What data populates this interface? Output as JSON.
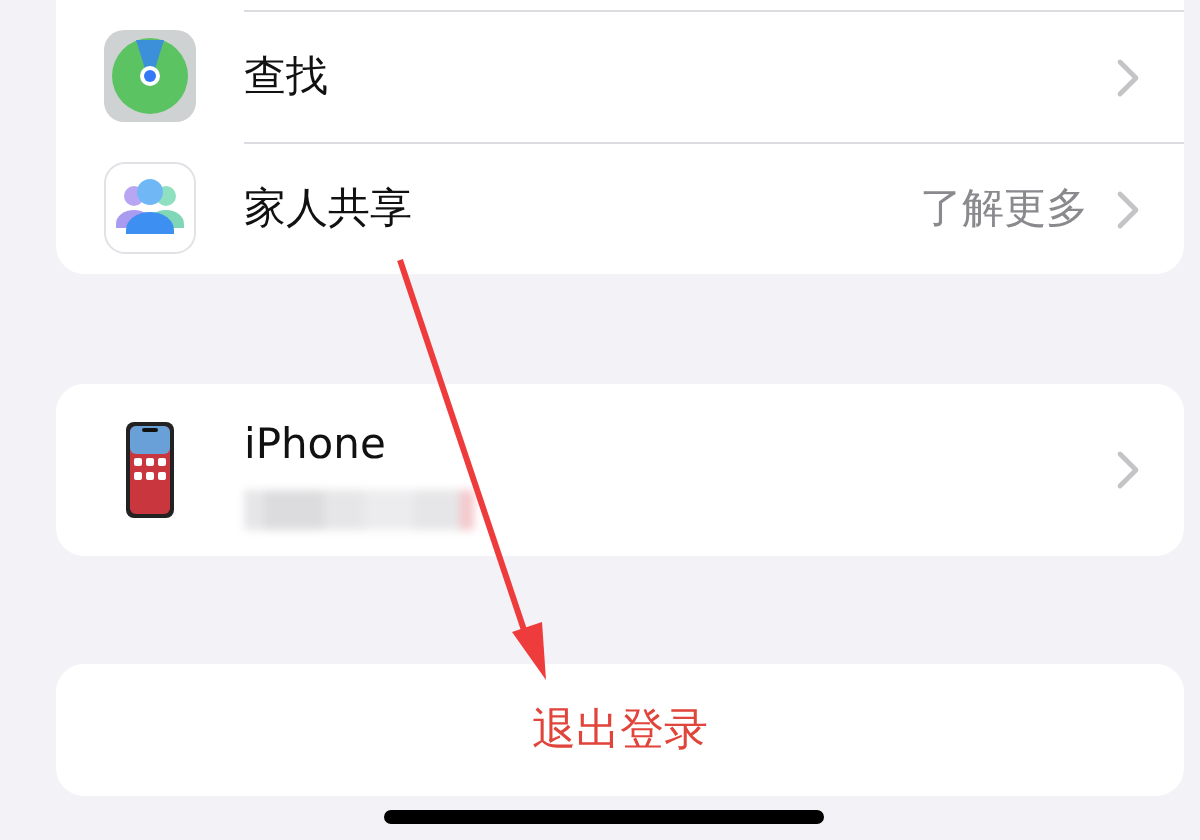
{
  "groups": [
    {
      "rows": [
        {
          "label": "查找",
          "kind": "find"
        },
        {
          "label": "家人共享",
          "detail": "了解更多",
          "kind": "family"
        }
      ]
    },
    {
      "rows": [
        {
          "label": "iPhone",
          "kind": "device"
        }
      ]
    }
  ],
  "sign_out": {
    "label": "退出登录"
  }
}
